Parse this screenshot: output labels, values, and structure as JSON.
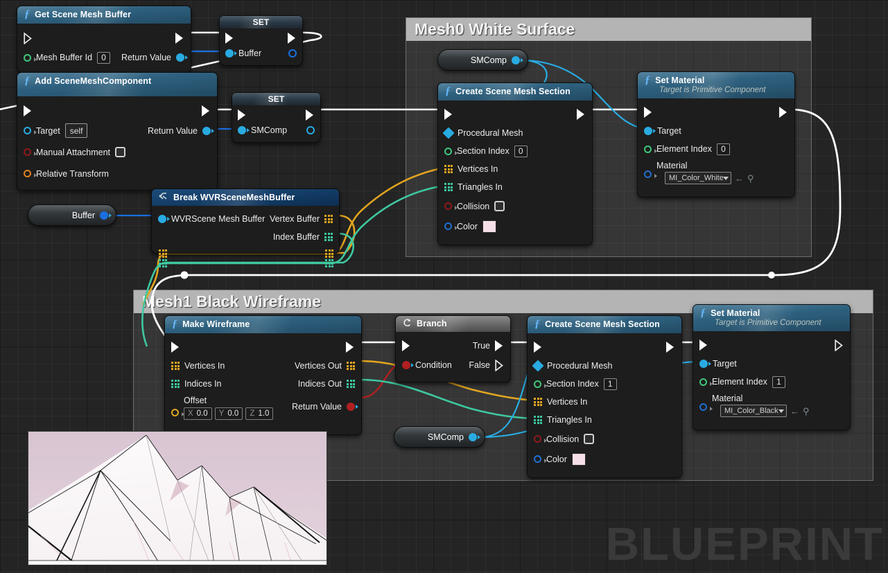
{
  "app": {
    "watermark": "BLUEPRINT",
    "canvas": {
      "grid_color": "#2f2f2f",
      "background": "#242424"
    }
  },
  "comments": [
    {
      "id": "mesh0",
      "title": "Mesh0 White Surface",
      "color": "#b4b4b4"
    },
    {
      "id": "mesh1",
      "title": "Mesh1 Black Wireframe",
      "color": "#b4b4b4"
    }
  ],
  "nodes": {
    "get_scene_mesh_buffer": {
      "title": "Get Scene Mesh Buffer",
      "icon": "function-icon",
      "inputs": [
        {
          "label": "Mesh Buffer Id",
          "value": "0",
          "pin": "green-circle"
        }
      ],
      "outputs": [
        {
          "label": "Return Value",
          "pin": "blue-dot"
        }
      ]
    },
    "set_buffer": {
      "title": "SET",
      "input_label": "Buffer"
    },
    "add_scene_mesh_component": {
      "title": "Add SceneMeshComponent",
      "icon": "function-icon",
      "inputs": [
        {
          "label": "Target",
          "value": "self",
          "pin": "blue-circle"
        },
        {
          "label": "Manual Attachment",
          "value": "",
          "pin": "red-circle",
          "widget": "checkbox"
        },
        {
          "label": "Relative Transform",
          "pin": "orange-circle"
        }
      ],
      "outputs": [
        {
          "label": "Return Value",
          "pin": "blue-dot"
        }
      ]
    },
    "set_smcomp": {
      "title": "SET",
      "input_label": "SMComp"
    },
    "buffer_var": {
      "label": "Buffer"
    },
    "break_buffer": {
      "title": "Break WVRSceneMeshBuffer",
      "icon": "break-struct-icon",
      "inputs": [
        {
          "label": "WVRScene Mesh Buffer",
          "pin": "blue-dot"
        }
      ],
      "outputs": [
        {
          "label": "Vertex Buffer",
          "pin": "orange-array"
        },
        {
          "label": "Index Buffer",
          "pin": "green-array"
        }
      ]
    },
    "smcomp_var_top": {
      "label": "SMComp"
    },
    "smcomp_var_bottom": {
      "label": "SMComp"
    },
    "create_section_0": {
      "title": "Create Scene Mesh Section",
      "icon": "function-icon",
      "inputs": [
        {
          "label": "Procedural Mesh",
          "pin": "blue-diamond"
        },
        {
          "label": "Section Index",
          "value": "0",
          "pin": "green-circle"
        },
        {
          "label": "Vertices In",
          "pin": "orange-array"
        },
        {
          "label": "Triangles In",
          "pin": "green-array"
        },
        {
          "label": "Collision",
          "pin": "red-circle",
          "widget": "checkbox"
        },
        {
          "label": "Color",
          "pin": "blue-circle",
          "widget": "color",
          "color": "#f6dfe8"
        }
      ]
    },
    "set_material_0": {
      "title": "Set Material",
      "subtitle": "Target is Primitive Component",
      "icon": "function-icon",
      "inputs": [
        {
          "label": "Target",
          "pin": "blue-dot"
        },
        {
          "label": "Element Index",
          "value": "0",
          "pin": "green-circle"
        },
        {
          "label": "Material",
          "value": "MI_Color_White_I",
          "pin": "blue-circle",
          "widget": "asset-combo"
        }
      ]
    },
    "make_wireframe": {
      "title": "Make Wireframe",
      "icon": "function-icon",
      "inputs": [
        {
          "label": "Vertices In",
          "pin": "orange-array"
        },
        {
          "label": "Indices In",
          "pin": "green-array"
        },
        {
          "label": "Offset",
          "pin": "orange-circle",
          "widget": "vector",
          "vector": {
            "x_label": "X",
            "x": "0.0",
            "y_label": "Y",
            "y": "0.0",
            "z_label": "Z",
            "z": "1.0"
          }
        }
      ],
      "outputs": [
        {
          "label": "Vertices Out",
          "pin": "orange-array"
        },
        {
          "label": "Indices Out",
          "pin": "green-array"
        },
        {
          "label": "Return Value",
          "pin": "red-dot"
        }
      ]
    },
    "branch": {
      "title": "Branch",
      "icon": "branch-icon",
      "inputs": [
        {
          "label": "Condition",
          "pin": "red-dot"
        }
      ],
      "outputs": [
        {
          "label": "True",
          "pin": "exec"
        },
        {
          "label": "False",
          "pin": "exec-hollow"
        }
      ]
    },
    "create_section_1": {
      "title": "Create Scene Mesh Section",
      "icon": "function-icon",
      "inputs": [
        {
          "label": "Procedural Mesh",
          "pin": "blue-diamond"
        },
        {
          "label": "Section Index",
          "value": "1",
          "pin": "green-circle"
        },
        {
          "label": "Vertices In",
          "pin": "orange-array"
        },
        {
          "label": "Triangles In",
          "pin": "green-array"
        },
        {
          "label": "Collision",
          "pin": "red-circle",
          "widget": "checkbox"
        },
        {
          "label": "Color",
          "pin": "blue-circle",
          "widget": "color",
          "color": "#f6dfe8"
        }
      ]
    },
    "set_material_1": {
      "title": "Set Material",
      "subtitle": "Target is Primitive Component",
      "icon": "function-icon",
      "inputs": [
        {
          "label": "Target",
          "pin": "blue-dot"
        },
        {
          "label": "Element Index",
          "value": "1",
          "pin": "green-circle"
        },
        {
          "label": "Material",
          "value": "MI_Color_Black_I",
          "pin": "blue-circle",
          "widget": "asset-combo"
        }
      ]
    }
  },
  "preview": {
    "name": "mountain-wireframe-render",
    "sky_color": "#ddc9d6",
    "surface_color": "#fbf7f8"
  },
  "wire_colors": {
    "exec": "#ffffff",
    "object": "#29abe2",
    "struct_array_orange": "#e2a520",
    "int_array_green": "#3ec8a0",
    "blue_data": "#1a6fe0"
  }
}
